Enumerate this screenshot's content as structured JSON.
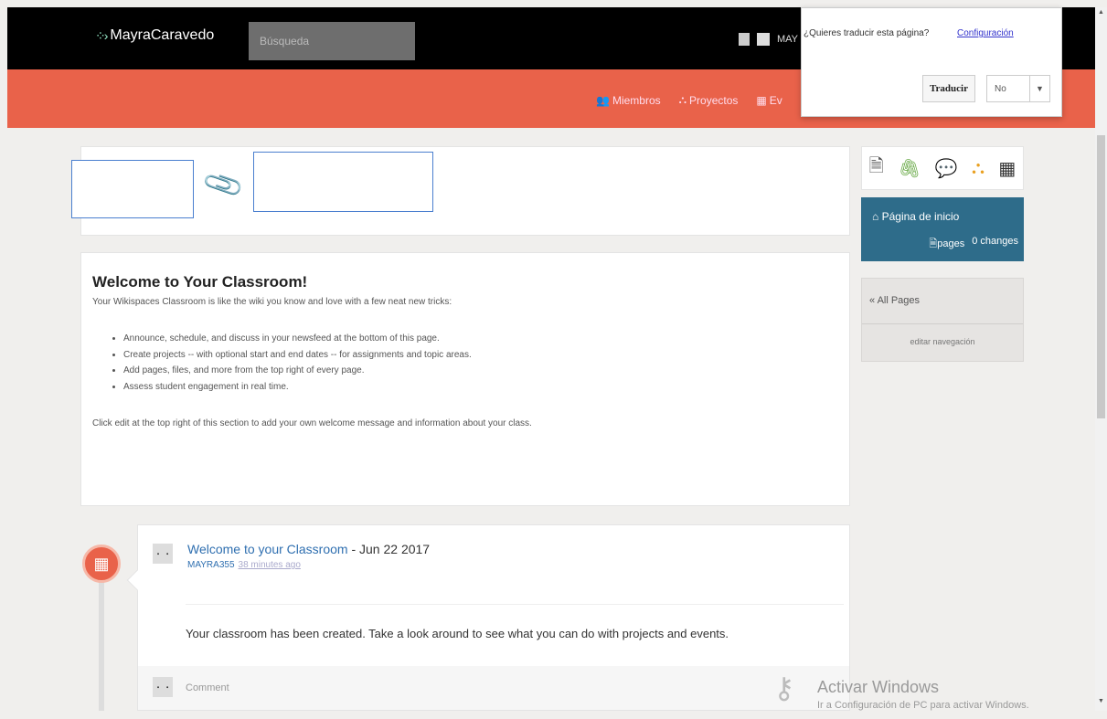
{
  "header": {
    "brand": "MayraCaravedo",
    "search_placeholder": "Búsqueda",
    "user_short": "MAY"
  },
  "nav": {
    "members": "Miembros",
    "projects": "Proyectos",
    "events": "Ev"
  },
  "translate_popup": {
    "question": "¿Quieres traducir esta página?",
    "config_link": "Configuración",
    "translate_button": "Traducir",
    "no_option": "No"
  },
  "welcome": {
    "title": "Welcome to Your Classroom!",
    "intro": "Your Wikispaces Classroom is like the wiki you know and love with a few neat new tricks:",
    "bullets": [
      "Announce, schedule, and discuss in your newsfeed at the bottom of this page.",
      "Create projects -- with optional start and end dates -- for assignments and topic areas.",
      "Add pages, files, and more from the top right of every page.",
      "Assess student engagement in real time."
    ],
    "outro": "Click edit at the top right of this section to add your own welcome message and information about your class."
  },
  "sidebar": {
    "home_label": "Página de inicio",
    "pages_label": "pages",
    "changes_count": "0",
    "changes_label": "changes",
    "all_pages": "« All Pages",
    "edit_nav": "editar navegación"
  },
  "feed": {
    "title": "Welcome to your Classroom",
    "date": " - Jun 22 2017",
    "author": "MAYRA355",
    "time_ago": "38 minutes ago",
    "body": "Your classroom has been created. Take a look around to see what you can do with projects and events.",
    "comment_placeholder": "Comment"
  },
  "watermark": {
    "line1": "Activar Windows",
    "line2": "Ir a Configuración de PC para activar Windows."
  },
  "colors": {
    "accent_orange": "#e9624a",
    "home_blue": "#2e6c8a",
    "link_blue": "#2f6fb0"
  }
}
